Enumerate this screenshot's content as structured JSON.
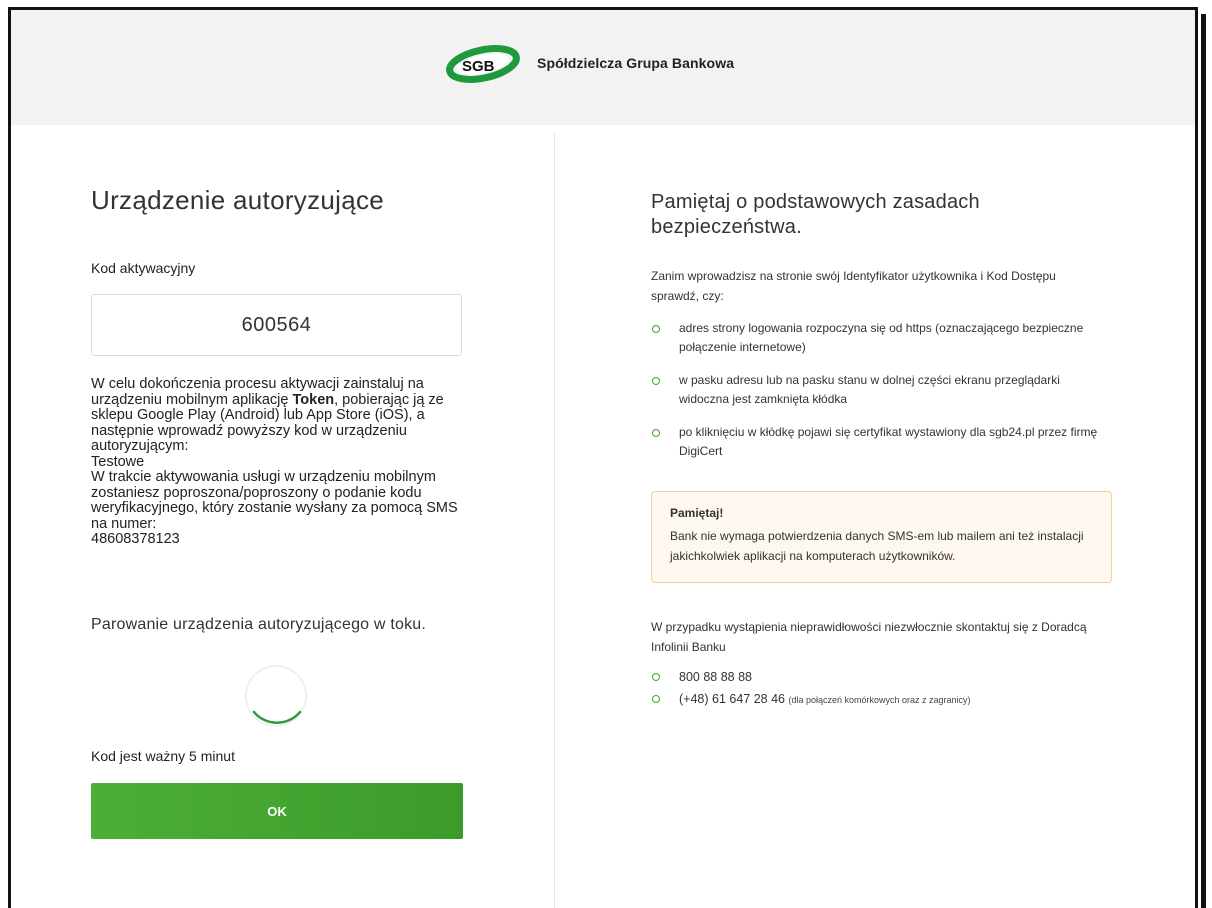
{
  "header": {
    "logo_text": "SGB",
    "bank_name": "Spółdzielcza Grupa Bankowa",
    "brand_color": "#1e9a3d"
  },
  "left": {
    "title": "Urządzenie autoryzujące",
    "code_label": "Kod aktywacyjny",
    "code_value": "600564",
    "instructions_1": "W celu dokończenia procesu aktywacji zainstaluj na urządzeniu mobilnym aplikację ",
    "instructions_app": "Token",
    "instructions_2": ", pobierając ją ze sklepu Google Play (Android) lub App Store (iOS), a następnie wprowadź powyższy kod w urządzeniu autoryzującym:",
    "device_name": "Testowe",
    "instructions_3": "W trakcie aktywowania usługi w urządzeniu mobilnym zostaniesz poproszona/poproszony o podanie kodu weryfikacyjnego, który zostanie wysłany za pomocą SMS na numer:",
    "phone_number": "48608378123",
    "pairing_status": "Parowanie urządzenia autoryzującego w toku.",
    "validity": "Kod jest ważny 5 minut",
    "ok_button": "OK"
  },
  "right": {
    "title": "Pamiętaj o podstawowych zasadach bezpieczeństwa.",
    "intro": "Zanim wprowadzisz na stronie swój Identyfikator użytkownika i Kod Dostępu sprawdź, czy:",
    "checks": [
      "adres strony logowania rozpoczyna się od https (oznaczającego bezpieczne połączenie internetowe)",
      "w pasku adresu lub na pasku stanu w dolnej części ekranu przeglądarki widoczna jest zamknięta kłódka",
      "po kliknięciu w kłódkę pojawi się certyfikat wystawiony dla sgb24.pl przez firmę DigiCert"
    ],
    "notice_title": "Pamiętaj!",
    "notice_text": "Bank nie wymaga potwierdzenia danych SMS-em lub mailem ani też instalacji jakichkolwiek aplikacji na komputerach użytkowników.",
    "contact_intro": "W przypadku wystąpienia nieprawidłowości niezwłocznie skontaktuj się z Doradcą Infolinii Banku",
    "phones": [
      {
        "number": "800 88 88 88",
        "note": ""
      },
      {
        "number": "(+48) 61 647 28 46",
        "note": "(dla połączeń komórkowych oraz z zagranicy)"
      }
    ]
  }
}
